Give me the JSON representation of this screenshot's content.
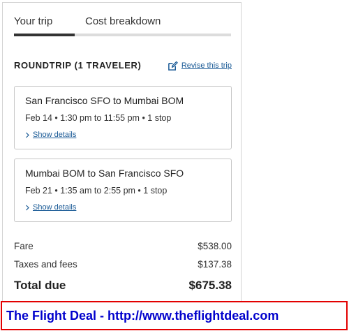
{
  "tabs": [
    {
      "label": "Your trip",
      "active": true
    },
    {
      "label": "Cost breakdown",
      "active": false
    }
  ],
  "trip": {
    "heading": "ROUNDTRIP (1 TRAVELER)",
    "revise_label": "Revise this trip",
    "revise_icon": "edit-icon"
  },
  "flights": [
    {
      "route": "San Francisco SFO to Mumbai BOM",
      "info": "Feb 14 • 1:30 pm to 11:55 pm • 1 stop",
      "details_label": "Show details"
    },
    {
      "route": "Mumbai BOM to San Francisco SFO",
      "info": "Feb 21 • 1:35 am to 2:55 pm • 1 stop",
      "details_label": "Show details"
    }
  ],
  "costs": {
    "fare_label": "Fare",
    "fare_value": "$538.00",
    "taxes_label": "Taxes and fees",
    "taxes_value": "$137.38",
    "total_label": "Total due",
    "total_value": "$675.38"
  },
  "banner": {
    "text": "The Flight Deal - http://www.theflightdeal.com"
  },
  "colors": {
    "link": "#1a5a96",
    "active_tab_bar": "#333333",
    "banner_border": "#e30000",
    "banner_text": "#0000cc"
  }
}
